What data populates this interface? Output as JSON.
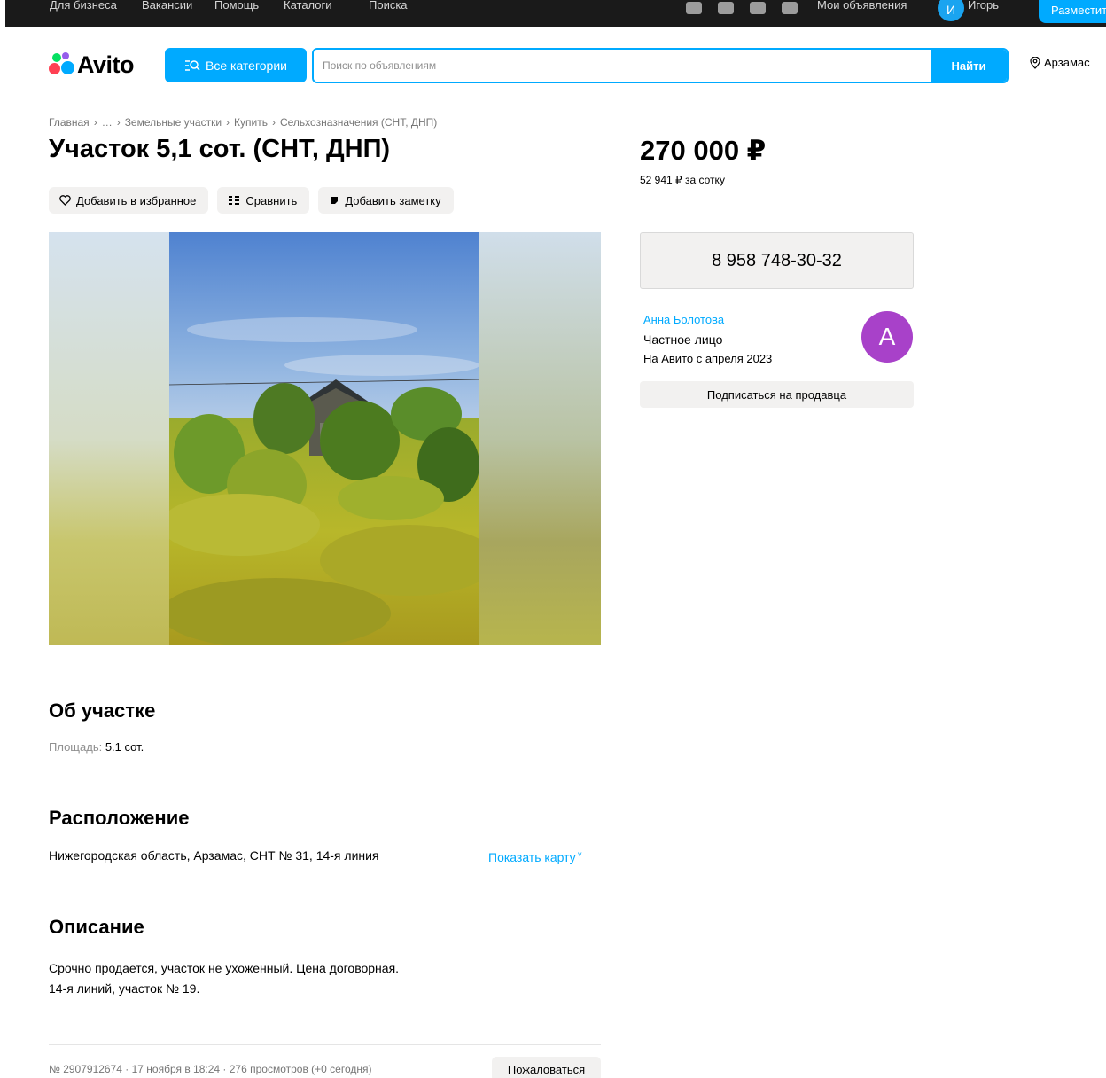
{
  "topbar": {
    "links": [
      "Для бизнеса",
      "Вакансии",
      "Помощь",
      "Каталоги",
      "Поиска"
    ],
    "my_ads": "Мои объявления",
    "user_avatar_letter": "И",
    "user_name": "Игорь",
    "post_button": "Разместить"
  },
  "header": {
    "logo": "Avito",
    "categories_button": "Все категории",
    "search_placeholder": "Поиск по объявлениям",
    "search_button": "Найти",
    "location": "Арзамас"
  },
  "breadcrumbs": [
    "Главная",
    "…",
    "Земельные участки",
    "Купить",
    "Сельхозназначения (СНТ, ДНП)"
  ],
  "title": "Участок 5,1 сот. (СНТ, ДНП)",
  "actions": {
    "favorite": "Добавить в избранное",
    "compare": "Сравнить",
    "note": "Добавить заметку"
  },
  "price": {
    "value": "270 000 ₽",
    "per_unit": "52 941 ₽ за сотку"
  },
  "phone": "8 958 748-30-32",
  "seller": {
    "name": "Анна Болотова",
    "type": "Частное лицо",
    "since": "На Авито с апреля 2023",
    "avatar_letter": "А",
    "avatar_color": "#a841c9",
    "subscribe_button": "Подписаться на продавца"
  },
  "about": {
    "heading": "Об участке",
    "area_label": "Площадь",
    "area_value": "5.1 сот."
  },
  "location_section": {
    "heading": "Расположение",
    "address": "Нижегородская область, Арзамас, СНТ № 31, 14-я линия",
    "show_map": "Показать карту"
  },
  "description": {
    "heading": "Описание",
    "line1": "Срочно продается, участок не ухоженный. Цена договорная.",
    "line2": "14-я линий, участок № 19."
  },
  "footer": {
    "meta": "№ 2907912674 · 17 ноября в 18:24 · 276 просмотров (+0 сегодня)",
    "complain_button": "Пожаловаться"
  },
  "colors": {
    "accent": "#00aaff",
    "topbar": "#1a1a1a",
    "button_gray": "#f2f1f0"
  }
}
